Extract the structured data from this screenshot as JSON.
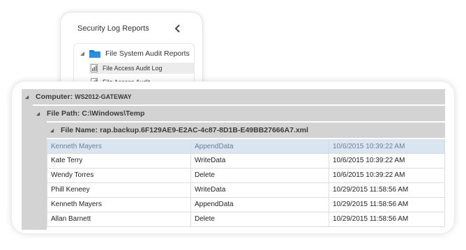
{
  "nav": {
    "header": "Security Log Reports",
    "folder_label": "File System Audit Reports",
    "items": [
      {
        "label": "File Access Audit Log",
        "selected": true
      },
      {
        "label": "File Access Audit",
        "selected": false
      }
    ]
  },
  "grid": {
    "computer": {
      "label": "Computer:",
      "value": "WS2012-GATEWAY"
    },
    "file_path": {
      "label": "File Path:",
      "value": "C:\\Windows\\Temp"
    },
    "file_name": {
      "label": "File Name:",
      "value": "rap.backup.6F129AE9-E2AC-4c87-8D1B-E49BB27666A7.xml"
    },
    "rows": [
      {
        "user": "Kenneth Mayers",
        "action": "AppendData",
        "time": "10/6/2015 10:39:22 AM",
        "selected": true
      },
      {
        "user": "Kate Terry",
        "action": "WriteData",
        "time": "10/6/2015 10:39:22 AM",
        "selected": false
      },
      {
        "user": "Wendy Torres",
        "action": "Delete",
        "time": "10/6/2015 10:39:22 AM",
        "selected": false
      },
      {
        "user": "Phill Keneey",
        "action": "WriteData",
        "time": "10/29/2015 11:58:56 AM",
        "selected": false
      },
      {
        "user": "Kenneth Mayers",
        "action": "AppendData",
        "time": "10/29/2015 11:58:56 AM",
        "selected": false
      },
      {
        "user": "Allan Barnett",
        "action": "Delete",
        "time": "10/29/2015 11:58:56 AM",
        "selected": false
      }
    ]
  },
  "colors": {
    "group_header": "#d3d3d3",
    "selection": "#d9e6f2",
    "folder": "#1a7fd0"
  },
  "icons": {
    "collapse": "chevron-left-icon",
    "expander": "triangle-expanded-icon",
    "folder": "folder-icon",
    "report": "report-icon"
  }
}
